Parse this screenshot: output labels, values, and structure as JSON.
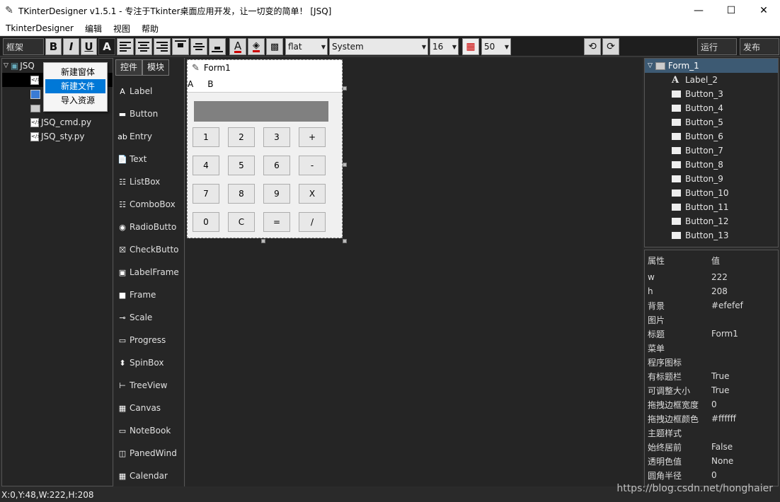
{
  "window": {
    "title": "TKinterDesigner v1.5.1 - 专注于Tkinter桌面应用开发，让一切变的简单！   [JSQ]",
    "controls": [
      "—",
      "☐",
      "✕"
    ]
  },
  "menubar": [
    "TkinterDesigner",
    "编辑",
    "视图",
    "帮助"
  ],
  "toolbar": {
    "frame_label": "框架",
    "bold": "B",
    "italic": "I",
    "underline": "U",
    "font_a": "A",
    "color_a": "A",
    "relief": "flat",
    "font_family": "System",
    "font_size": "16",
    "grid_size": "50",
    "run_label": "运行",
    "publish_label": "发布"
  },
  "project": {
    "root": "JSQ",
    "files": [
      "JSQ_cmd.py",
      "JSQ_sty.py"
    ]
  },
  "context_menu": [
    "新建窗体",
    "新建文件",
    "导入资源"
  ],
  "palette": {
    "tabs": [
      "控件",
      "模块"
    ],
    "items": [
      {
        "label": "Label",
        "icon": "A"
      },
      {
        "label": "Button",
        "icon": "▬"
      },
      {
        "label": "Entry",
        "icon": "ab"
      },
      {
        "label": "Text",
        "icon": "📄"
      },
      {
        "label": "ListBox",
        "icon": "☷"
      },
      {
        "label": "ComboBox",
        "icon": "☷"
      },
      {
        "label": "RadioButto",
        "icon": "◉"
      },
      {
        "label": "CheckButto",
        "icon": "☒"
      },
      {
        "label": "LabelFrame",
        "icon": "▣"
      },
      {
        "label": "Frame",
        "icon": "■"
      },
      {
        "label": "Scale",
        "icon": "⊸"
      },
      {
        "label": "Progress",
        "icon": "▭"
      },
      {
        "label": "SpinBox",
        "icon": "⬍"
      },
      {
        "label": "TreeView",
        "icon": "⊢"
      },
      {
        "label": "Canvas",
        "icon": "▦"
      },
      {
        "label": "NoteBook",
        "icon": "▭"
      },
      {
        "label": "PanedWind",
        "icon": "◫"
      },
      {
        "label": "Calendar",
        "icon": "▦"
      }
    ]
  },
  "form": {
    "title": "Form1",
    "menu": [
      "A",
      "B"
    ],
    "buttons": [
      [
        "1",
        "2",
        "3",
        "+"
      ],
      [
        "4",
        "5",
        "6",
        "-"
      ],
      [
        "7",
        "8",
        "9",
        "X"
      ],
      [
        "0",
        "C",
        "=",
        "/"
      ]
    ]
  },
  "tree": {
    "root": "Form_1",
    "items": [
      "Label_2",
      "Button_3",
      "Button_4",
      "Button_5",
      "Button_6",
      "Button_7",
      "Button_8",
      "Button_9",
      "Button_10",
      "Button_11",
      "Button_12",
      "Button_13"
    ]
  },
  "properties": {
    "header_key": "属性",
    "header_value": "值",
    "rows": [
      {
        "k": "w",
        "v": "222"
      },
      {
        "k": "h",
        "v": "208"
      },
      {
        "k": "背景",
        "v": "#efefef"
      },
      {
        "k": "图片",
        "v": ""
      },
      {
        "k": "标题",
        "v": "Form1"
      },
      {
        "k": "菜单",
        "v": ""
      },
      {
        "k": "程序图标",
        "v": ""
      },
      {
        "k": "有标题栏",
        "v": "True"
      },
      {
        "k": "可调整大小",
        "v": "True"
      },
      {
        "k": "拖拽边框宽度",
        "v": "0"
      },
      {
        "k": "拖拽边框颜色",
        "v": "#ffffff"
      },
      {
        "k": "主题样式",
        "v": ""
      },
      {
        "k": "始终居前",
        "v": "False"
      },
      {
        "k": "透明色值",
        "v": "None"
      },
      {
        "k": "圆角半径",
        "v": "0"
      }
    ]
  },
  "status": "X:0,Y:48,W:222,H:208",
  "watermark": "https://blog.csdn.net/honghaier"
}
